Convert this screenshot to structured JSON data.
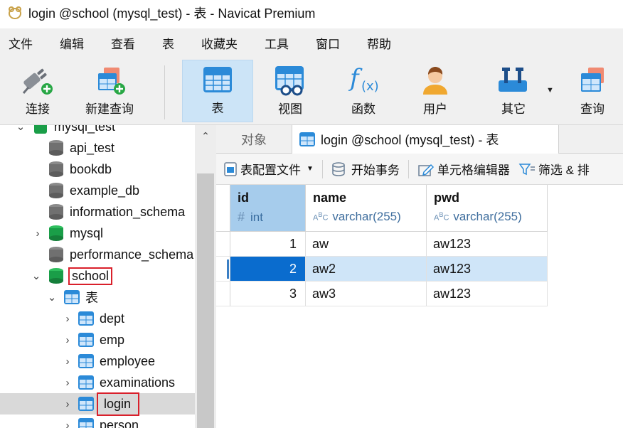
{
  "window": {
    "title": "login @school (mysql_test) - 表 - Navicat Premium"
  },
  "menu": [
    "文件",
    "编辑",
    "查看",
    "表",
    "收藏夹",
    "工具",
    "窗口",
    "帮助"
  ],
  "toolbar": {
    "connect": "连接",
    "new_query": "新建查询",
    "table": "表",
    "view": "视图",
    "function": "函数",
    "user": "用户",
    "other": "其它",
    "query": "查询"
  },
  "navigator": {
    "connection": "mysql_test",
    "databases": [
      "api_test",
      "bookdb",
      "example_db",
      "information_schema",
      "mysql",
      "performance_schema",
      "school"
    ],
    "tables_group": "表",
    "tables": [
      "dept",
      "emp",
      "employee",
      "examinations",
      "login",
      "person"
    ],
    "selected_table": "login"
  },
  "tabs": {
    "objects": "对象",
    "active": "login @school (mysql_test) - 表"
  },
  "object_toolbar": {
    "table_profile": "表配置文件",
    "begin_transaction": "开始事务",
    "cell_editor": "单元格编辑器",
    "filter_sort": "筛选 & 排"
  },
  "grid": {
    "columns": [
      {
        "name": "id",
        "type": "int",
        "type_icon": "hash-icon"
      },
      {
        "name": "name",
        "type": "varchar(255)",
        "type_icon": "abc-icon"
      },
      {
        "name": "pwd",
        "type": "varchar(255)",
        "type_icon": "abc-icon"
      }
    ],
    "rows": [
      {
        "id": "1",
        "name": "aw",
        "pwd": "aw123"
      },
      {
        "id": "2",
        "name": "aw2",
        "pwd": "aw123"
      },
      {
        "id": "3",
        "name": "aw3",
        "pwd": "aw123"
      }
    ],
    "selected_row_index": 1
  },
  "colors": {
    "highlight_box": "#d9202b",
    "selected_cell": "#0a6cce",
    "selected_row": "#cfe5f8",
    "db_active": "#1a9e48",
    "db_inactive": "#707070"
  }
}
